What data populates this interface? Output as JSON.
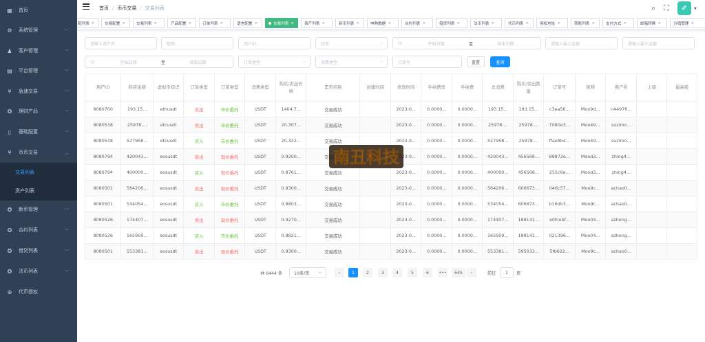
{
  "sidebar": {
    "items": [
      {
        "label": "首页",
        "icon": "dashboard-icon"
      },
      {
        "label": "系统管理",
        "icon": "gear-icon"
      },
      {
        "label": "客户管理",
        "icon": "user-icon"
      },
      {
        "label": "平台管理",
        "icon": "grid-icon"
      },
      {
        "label": "急速交易",
        "icon": "yen-icon"
      },
      {
        "label": "理财产品",
        "icon": "product-icon"
      },
      {
        "label": "基础配置",
        "icon": "book-icon"
      },
      {
        "label": "币币交易",
        "icon": "yen-icon"
      },
      {
        "label": "新币管理",
        "icon": "product-icon"
      },
      {
        "label": "合约列表",
        "icon": "product-icon"
      },
      {
        "label": "借贷列表",
        "icon": "product-icon"
      },
      {
        "label": "法币列表",
        "icon": "product-icon"
      },
      {
        "label": "代币授权",
        "icon": "authorize-icon"
      }
    ],
    "sub_items": [
      {
        "label": "交易列表",
        "active": true
      },
      {
        "label": "资产列表",
        "active": false
      }
    ]
  },
  "navbar": {
    "breadcrumb": [
      "首页",
      "币币交易",
      "交易列表"
    ],
    "avatar_glyph": "✐"
  },
  "tags": [
    {
      "label": "配列表"
    },
    {
      "label": "交易配置"
    },
    {
      "label": "交易列表"
    },
    {
      "label": "产品配置"
    },
    {
      "label": "订单列表"
    },
    {
      "label": "语言配置"
    },
    {
      "label": "交易列表",
      "active": true
    },
    {
      "label": "资产列表"
    },
    {
      "label": "新币列表"
    },
    {
      "label": "申购数据"
    },
    {
      "label": "合约列表"
    },
    {
      "label": "借贷列表"
    },
    {
      "label": "法币列表"
    },
    {
      "label": "代币列表"
    },
    {
      "label": "授权地址"
    },
    {
      "label": "转账列表"
    },
    {
      "label": "支付方式"
    },
    {
      "label": "邮箱转换"
    },
    {
      "label": "分销管理"
    }
  ],
  "filters": {
    "username": "请输入用户名",
    "nickname": "昵称",
    "user_id": "用户ID",
    "status": "状态",
    "start_date": "开始日期",
    "to": "至",
    "end_date": "结束日期",
    "min_amount": "请输入最小金额",
    "max_amount": "请输入最大金额",
    "order_type": "订单类型",
    "consume_type": "消费类型",
    "order_no": "订单号",
    "reset_label": "重置",
    "search_label": "查询"
  },
  "table": {
    "headers": [
      "用户ID",
      "购买金额",
      "虚拟币标识",
      "订单类型",
      "订单类型",
      "消费类型",
      "购买/卖出价格",
      "是否控制",
      "创建时间",
      "修改时间",
      "手续费率",
      "手续费",
      "总消费",
      "购买/卖出数量",
      "订单号",
      "昵称",
      "用户名",
      "上级",
      "最高级"
    ],
    "rows": [
      [
        "8080700",
        "193.15...",
        "ethusdt",
        "卖出",
        "市价委托",
        "USDT",
        "1404.7...",
        "交易成功",
        "",
        "2023-0...",
        "0.0000...",
        "0.0000...",
        "193.15...",
        "193.15...",
        "c3ea56...",
        "Moo9d...",
        "n44976...",
        "",
        ""
      ],
      [
        "8080538",
        "25978....",
        "etcusdt",
        "卖出",
        "市价委托",
        "USDT",
        "20.307...",
        "交易成功",
        "",
        "2023-0...",
        "0.0000...",
        "0.0000...",
        "25978....",
        "25978....",
        "7080e3...",
        "Moo49...",
        "suzimo...",
        "",
        ""
      ],
      [
        "8080538",
        "527958...",
        "etcusdt",
        "买入",
        "市价委托",
        "USDT",
        "20.322...",
        "交易成功",
        "",
        "2023-0...",
        "0.0000...",
        "0.0000...",
        "527958...",
        "25978....",
        "ffae8b4...",
        "Moo49...",
        "suzimo...",
        "",
        ""
      ],
      [
        "8080794",
        "420043...",
        "eosusdt",
        "卖出",
        "现价委托",
        "USDT",
        "0.9200...",
        "交易成功",
        "",
        "2023-0...",
        "0.0000...",
        "0.0000...",
        "420043...",
        "456568...",
        "89872e...",
        "Mood3...",
        "zhing4...",
        "",
        ""
      ],
      [
        "8080794",
        "400000...",
        "eosusdt",
        "买入",
        "现价委托",
        "USDT",
        "0.8761...",
        "交易成功",
        "",
        "2023-0...",
        "0.0000...",
        "0.0000...",
        "400000...",
        "456568...",
        "255c6e...",
        "Mood3...",
        "zhing4...",
        "",
        ""
      ],
      [
        "8080501",
        "564206...",
        "eosusdt",
        "卖出",
        "现价委托",
        "USDT",
        "0.9300...",
        "交易成功",
        "",
        "2023-0...",
        "0.0000...",
        "0.0000...",
        "564206...",
        "606673...",
        "046c57...",
        "Moo9c...",
        "achao0...",
        "",
        ""
      ],
      [
        "8080501",
        "534054...",
        "eosusdt",
        "买入",
        "市价委托",
        "USDT",
        "0.8803...",
        "交易成功",
        "",
        "2023-0...",
        "0.0000...",
        "0.0000...",
        "534054...",
        "606673...",
        "b16db3...",
        "Moo9c...",
        "achao0...",
        "",
        ""
      ],
      [
        "8080526",
        "174407...",
        "eosusdt",
        "卖出",
        "现价委托",
        "USDT",
        "0.9270...",
        "交易成功",
        "",
        "2023-0...",
        "0.0000...",
        "0.0000...",
        "174407...",
        "188141...",
        "e0fcebf...",
        "Moo04...",
        "azheng...",
        "",
        ""
      ],
      [
        "8080526",
        "165959...",
        "eosusdt",
        "买入",
        "市价委托",
        "USDT",
        "0.8821...",
        "交易成功",
        "",
        "2023-0...",
        "0.0000...",
        "0.0000...",
        "165959...",
        "188141...",
        "021396...",
        "Moo04...",
        "azheng...",
        "",
        ""
      ],
      [
        "8080501",
        "553381...",
        "eosusdt",
        "卖出",
        "现价委托",
        "USDT",
        "0.9300...",
        "交易成功",
        "",
        "2023-0...",
        "0.0000...",
        "0.0000...",
        "553381...",
        "595033...",
        "5fb622...",
        "Moo9c...",
        "achao0...",
        "",
        ""
      ]
    ]
  },
  "pagination": {
    "total": "共 6444 条",
    "page_size": "10条/页",
    "pages": [
      "1",
      "2",
      "3",
      "4",
      "5",
      "6",
      "•••",
      "645"
    ],
    "current": "1",
    "goto": "前往",
    "goto_value": "1",
    "page_unit": "页"
  },
  "watermark": {
    "text": "南丑科技"
  },
  "colors": {
    "sidebar": "#304156",
    "active_tag": "#42b983",
    "primary": "#1890ff",
    "sell": "#f56c6c",
    "buy": "#67c23a"
  }
}
